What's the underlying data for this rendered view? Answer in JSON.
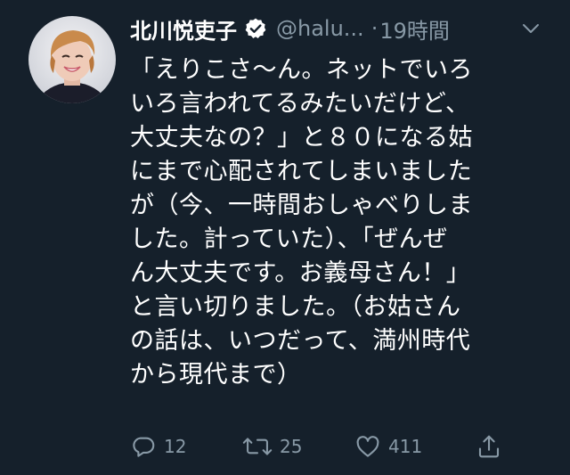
{
  "tweet": {
    "display_name": "北川悦吏子",
    "handle": "@halu...",
    "separator": "·",
    "time": "19時間",
    "body_lines": [
      "「えりこさ〜ん。ネットでいろ",
      "いろ言われてるみたいだけど、",
      "大丈夫なの？」と８０になる姑",
      "にまで心配されてしまいました",
      "が（今、一時間おしゃべりしま",
      "した。計っていた）、「ぜんぜ",
      "ん大丈夫です。お義母さん！」",
      "と言い切りました。（お姑さん",
      "の話は、いつだって、満州時代",
      "から現代まで）"
    ],
    "actions": {
      "reply_count": "12",
      "retweet_count": "25",
      "like_count": "411"
    }
  },
  "icons": {
    "verified": "verified-badge-icon",
    "caret": "chevron-down-icon",
    "reply": "reply-icon",
    "retweet": "retweet-icon",
    "like": "heart-icon",
    "share": "share-icon"
  },
  "colors": {
    "background": "#15202b",
    "text": "#ffffff",
    "secondary": "#8899a6"
  }
}
